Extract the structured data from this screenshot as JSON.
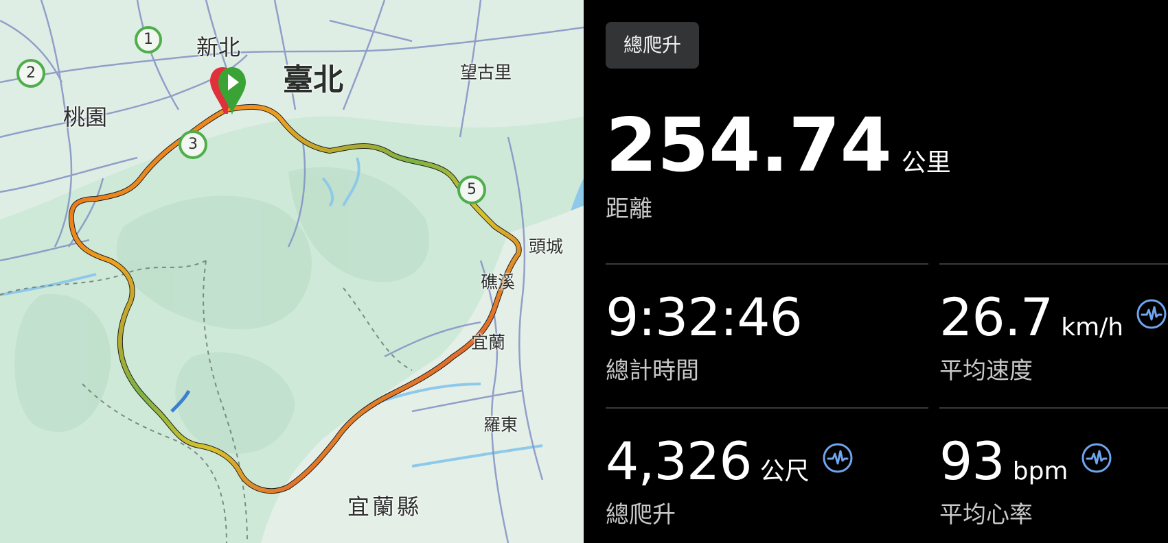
{
  "map": {
    "places": {
      "xinbei": "新北",
      "taipei": "臺北",
      "taoyuan": "桃園",
      "wangguli": "望古里",
      "toucheng": "頭城",
      "jiaoxi": "礁溪",
      "yilan": "宜蘭",
      "luodong": "羅東",
      "yilan_county": "宜蘭縣"
    },
    "route_markers": [
      "1",
      "2",
      "3",
      "5"
    ],
    "start_icon": "play-icon",
    "colors": {
      "land": "#cfe9d9",
      "sea": "#8fc9ea",
      "roads": "#6f7fb8",
      "start_marker": "#3aa335",
      "start_marker_back": "#e0313a"
    }
  },
  "stats": {
    "metric_chip": "總爬升",
    "distance": {
      "value": "254.74",
      "unit": "公里",
      "label": "距離"
    },
    "moving_time": {
      "value": "9:32:46",
      "label": "總計時間"
    },
    "avg_speed": {
      "value": "26.7",
      "unit": "km/h",
      "label": "平均速度",
      "icon": "heart-rate-wave-icon"
    },
    "elevation_gain": {
      "value": "4,326",
      "unit": "公尺",
      "label": "總爬升",
      "icon": "heart-rate-wave-icon"
    },
    "avg_hr": {
      "value": "93",
      "unit": "bpm",
      "label": "平均心率",
      "icon": "heart-rate-wave-icon"
    },
    "colors": {
      "accent_icon": "#6fa6ee",
      "background": "#000000",
      "chip": "#333436"
    }
  }
}
